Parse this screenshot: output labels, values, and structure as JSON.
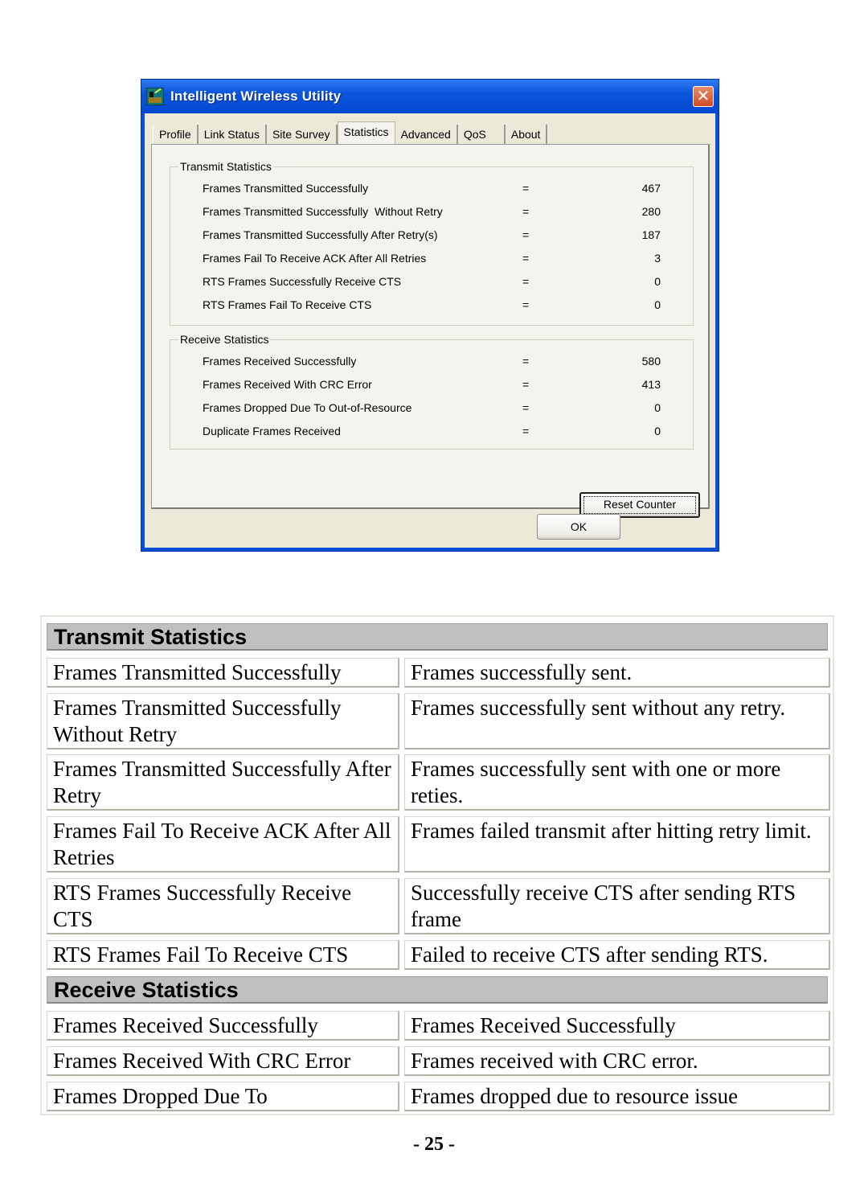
{
  "dialog": {
    "title": "Intelligent Wireless Utility",
    "close_symbol": "✕",
    "tabs": [
      {
        "label": "Profile",
        "active": false
      },
      {
        "label": "Link Status",
        "active": false
      },
      {
        "label": "Site Survey",
        "active": false
      },
      {
        "label": "Statistics",
        "active": true
      },
      {
        "label": "Advanced",
        "active": false
      },
      {
        "label": "QoS",
        "active": false
      },
      {
        "label": "About",
        "active": false
      }
    ],
    "transmit": {
      "title": "Transmit Statistics",
      "rows": [
        {
          "label": "Frames Transmitted Successfully",
          "eq": "=",
          "value": "467"
        },
        {
          "label": "Frames Transmitted Successfully  Without Retry",
          "eq": "=",
          "value": "280"
        },
        {
          "label": "Frames Transmitted Successfully After Retry(s)",
          "eq": "=",
          "value": "187"
        },
        {
          "label": "Frames Fail To Receive ACK After All Retries",
          "eq": "=",
          "value": "3"
        },
        {
          "label": "RTS Frames Successfully Receive CTS",
          "eq": "=",
          "value": "0"
        },
        {
          "label": "RTS Frames Fail To Receive CTS",
          "eq": "=",
          "value": "0"
        }
      ]
    },
    "receive": {
      "title": "Receive Statistics",
      "rows": [
        {
          "label": "Frames Received Successfully",
          "eq": "=",
          "value": "580"
        },
        {
          "label": "Frames Received With CRC Error",
          "eq": "=",
          "value": "413"
        },
        {
          "label": "Frames Dropped Due To Out-of-Resource",
          "eq": "=",
          "value": "0"
        },
        {
          "label": "Duplicate Frames Received",
          "eq": "=",
          "value": "0"
        }
      ]
    },
    "reset_button": "Reset Counter",
    "ok_button": "OK"
  },
  "doc_table": {
    "transmit_header": "Transmit Statistics",
    "transmit_rows": [
      {
        "term": "Frames Transmitted Successfully",
        "desc": "Frames successfully sent."
      },
      {
        "term": "Frames Transmitted Successfully Without Retry",
        "desc": "Frames successfully sent without any retry."
      },
      {
        "term": "Frames Transmitted Successfully After Retry",
        "desc": "Frames successfully sent with one or more reties."
      },
      {
        "term": "Frames Fail To Receive ACK After All Retries",
        "desc": "Frames failed transmit after hitting retry limit."
      },
      {
        "term": "RTS Frames Successfully Receive CTS",
        "desc": "Successfully receive CTS after sending RTS frame"
      },
      {
        "term": "RTS Frames Fail To Receive CTS",
        "desc": "Failed to receive CTS after sending RTS."
      }
    ],
    "receive_header": "Receive Statistics",
    "receive_rows": [
      {
        "term": "Frames Received Successfully",
        "desc": "Frames Received Successfully"
      },
      {
        "term": "Frames Received With CRC Error",
        "desc": "Frames received with CRC error."
      },
      {
        "term": "Frames Dropped Due To",
        "desc": "Frames dropped due to resource issue"
      }
    ]
  },
  "page_number": "- 25 -"
}
